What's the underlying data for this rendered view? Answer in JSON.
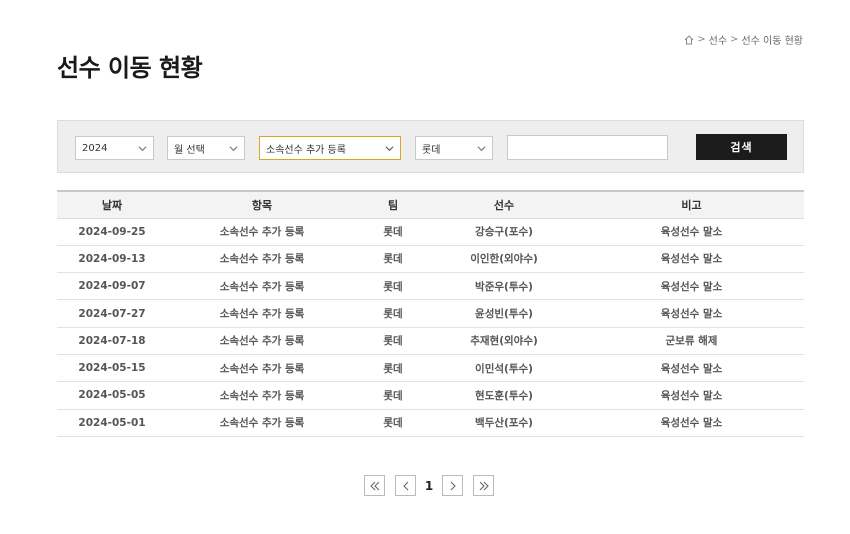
{
  "breadcrumb": {
    "items": [
      "선수",
      "선수 이동 현황"
    ],
    "separator": ">"
  },
  "page_title": "선수 이동 현황",
  "filters": {
    "year": "2024",
    "month": "월 선택",
    "item": "소속선수 추가 등록",
    "team": "롯데",
    "search_value": "",
    "search_label": "검색"
  },
  "table": {
    "headers": [
      "날짜",
      "항목",
      "팀",
      "선수",
      "비고"
    ],
    "rows": [
      [
        "2024-09-25",
        "소속선수 추가 등록",
        "롯데",
        "강승구(포수)",
        "육성선수 말소"
      ],
      [
        "2024-09-13",
        "소속선수 추가 등록",
        "롯데",
        "이인한(외야수)",
        "육성선수 말소"
      ],
      [
        "2024-09-07",
        "소속선수 추가 등록",
        "롯데",
        "박준우(투수)",
        "육성선수 말소"
      ],
      [
        "2024-07-27",
        "소속선수 추가 등록",
        "롯데",
        "윤성빈(투수)",
        "육성선수 말소"
      ],
      [
        "2024-07-18",
        "소속선수 추가 등록",
        "롯데",
        "추재현(외야수)",
        "군보류 해제"
      ],
      [
        "2024-05-15",
        "소속선수 추가 등록",
        "롯데",
        "이민석(투수)",
        "육성선수 말소"
      ],
      [
        "2024-05-05",
        "소속선수 추가 등록",
        "롯데",
        "현도훈(투수)",
        "육성선수 말소"
      ],
      [
        "2024-05-01",
        "소속선수 추가 등록",
        "롯데",
        "백두산(포수)",
        "육성선수 말소"
      ]
    ]
  },
  "pagination": {
    "current": "1"
  },
  "colors": {
    "accent_border": "#d9a528",
    "search_button_bg": "#1b1b1b",
    "filter_bg": "#eeeeee"
  },
  "icons": [
    "home-icon",
    "chevron-down-icon",
    "double-chevron-left-icon",
    "chevron-left-icon",
    "chevron-right-icon",
    "double-chevron-right-icon"
  ]
}
